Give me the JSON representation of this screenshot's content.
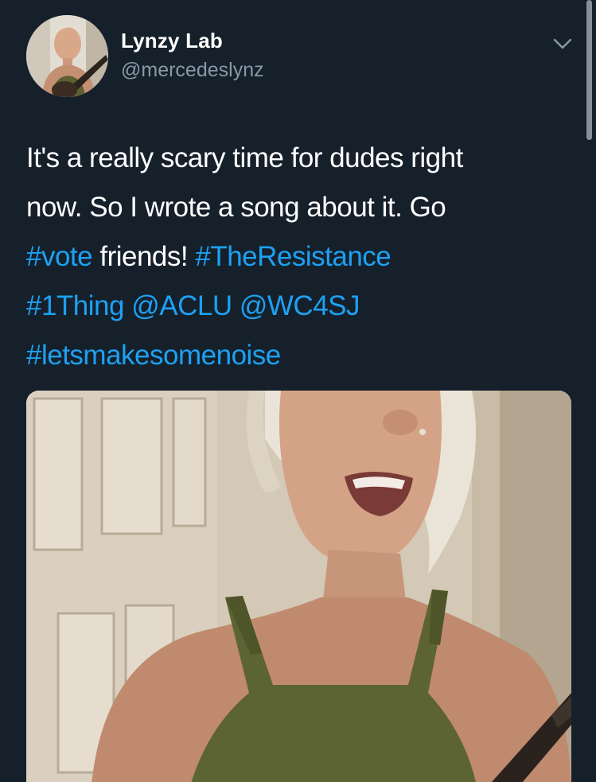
{
  "tweet": {
    "display_name": "Lynzy Lab",
    "handle": "@mercedeslynz",
    "text": {
      "line1": "It's a really scary time for dudes right",
      "line2": "now. So I wrote a song about it. Go",
      "line3_tag": "#vote",
      "line3_text": " friends! ",
      "line3_tag2": "#TheResistance",
      "line4_tag": "#1Thing",
      "line4_mention1": "@ACLU",
      "line4_mention2": "@WC4SJ",
      "line5_tag": "#letsmakesomenoise"
    }
  },
  "icons": {
    "menu": "chevron-down-icon"
  },
  "colors": {
    "background": "#15202b",
    "link": "#1da1f2",
    "secondary_text": "#8899a6"
  }
}
